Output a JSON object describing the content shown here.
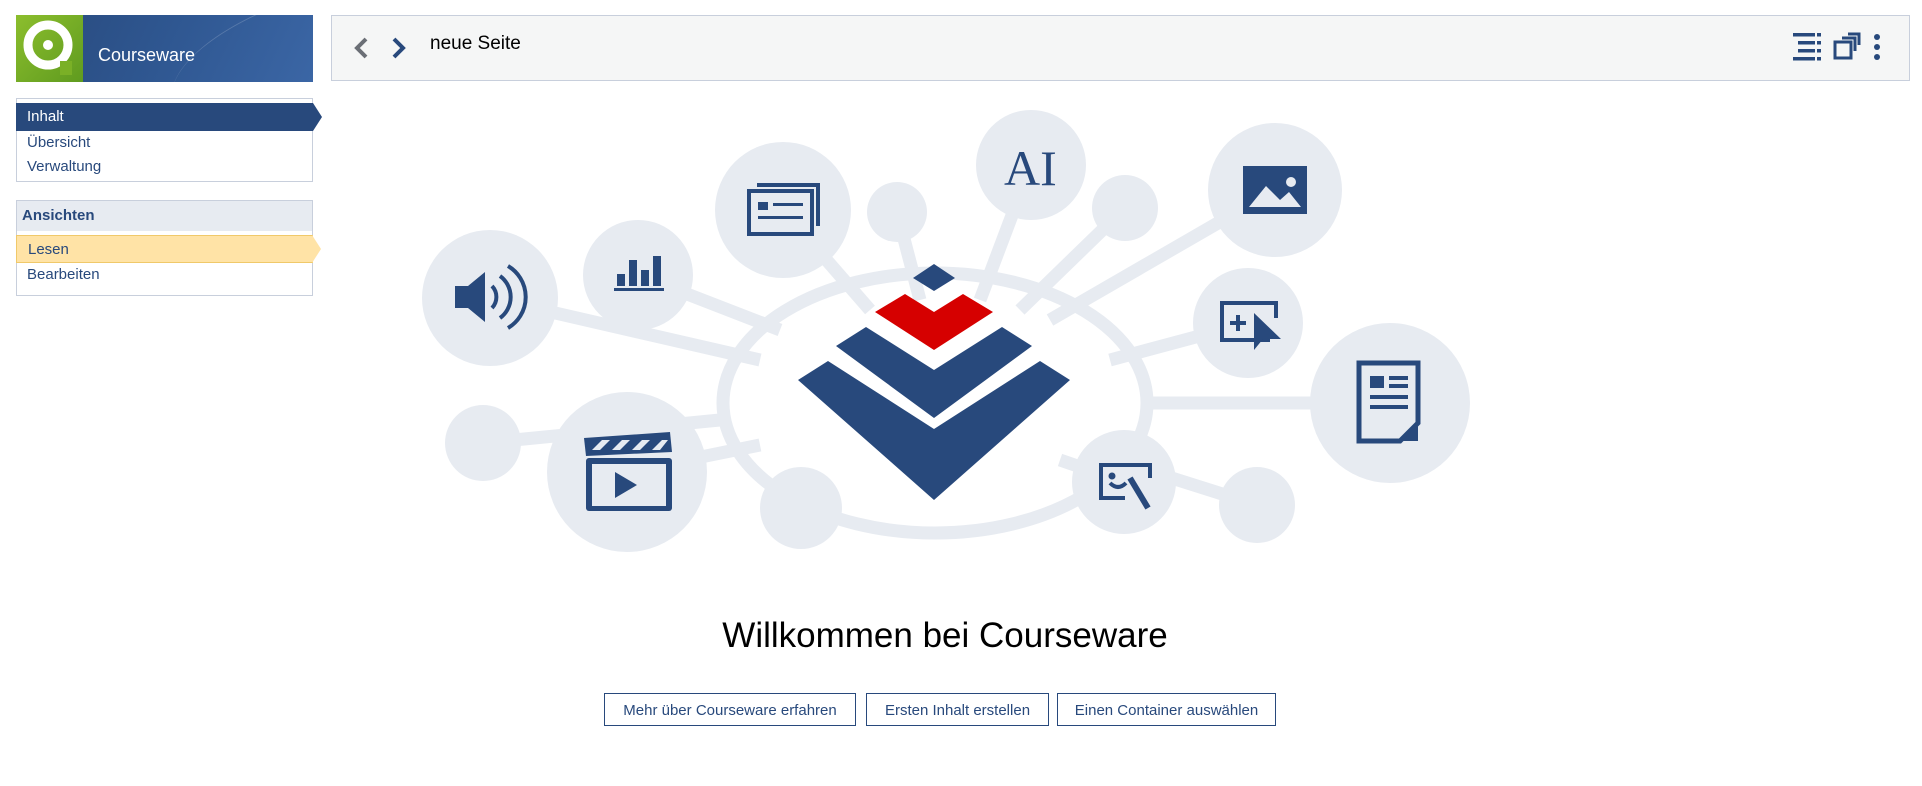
{
  "brand": {
    "title": "Courseware"
  },
  "nav": {
    "items": [
      {
        "label": "Inhalt",
        "active": true
      },
      {
        "label": "Übersicht",
        "active": false
      },
      {
        "label": "Verwaltung",
        "active": false
      }
    ]
  },
  "views": {
    "header": "Ansichten",
    "items": [
      {
        "label": "Lesen",
        "active": true
      },
      {
        "label": "Bearbeiten",
        "active": false
      }
    ]
  },
  "topbar": {
    "page_title": "neue Seite",
    "tools": [
      "list-outline-icon",
      "expand-window-icon",
      "kebab-menu-icon"
    ]
  },
  "colors": {
    "primary": "#28497c",
    "accent_red": "#d60000",
    "bubble": "#e7ebf1",
    "active_view": "#ffe3a6",
    "brand_green": "#8cbe2d"
  },
  "main": {
    "welcome": "Willkommen bei Courseware",
    "buttons": {
      "learn_more": "Mehr über Courseware erfahren",
      "first_content": "Ersten Inhalt erstellen",
      "select_container": "Einen Container auswählen"
    }
  }
}
